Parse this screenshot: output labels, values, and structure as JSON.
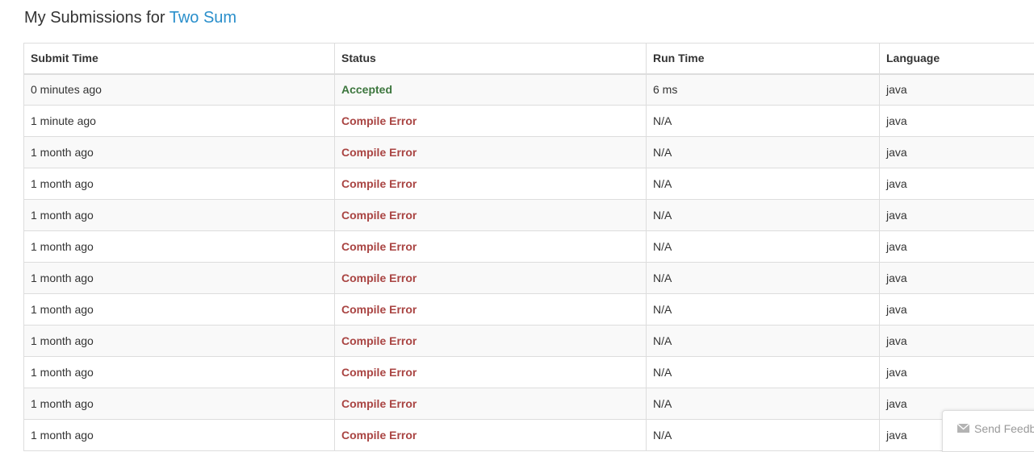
{
  "heading": {
    "prefix": "My Submissions for",
    "problem_link": "Two Sum"
  },
  "table": {
    "columns": [
      "Submit Time",
      "Status",
      "Run Time",
      "Language"
    ],
    "rows": [
      {
        "time": "0 minutes ago",
        "status": "Accepted",
        "runtime": "6 ms",
        "language": "java"
      },
      {
        "time": "1 minute ago",
        "status": "Compile Error",
        "runtime": "N/A",
        "language": "java"
      },
      {
        "time": "1 month ago",
        "status": "Compile Error",
        "runtime": "N/A",
        "language": "java"
      },
      {
        "time": "1 month ago",
        "status": "Compile Error",
        "runtime": "N/A",
        "language": "java"
      },
      {
        "time": "1 month ago",
        "status": "Compile Error",
        "runtime": "N/A",
        "language": "java"
      },
      {
        "time": "1 month ago",
        "status": "Compile Error",
        "runtime": "N/A",
        "language": "java"
      },
      {
        "time": "1 month ago",
        "status": "Compile Error",
        "runtime": "N/A",
        "language": "java"
      },
      {
        "time": "1 month ago",
        "status": "Compile Error",
        "runtime": "N/A",
        "language": "java"
      },
      {
        "time": "1 month ago",
        "status": "Compile Error",
        "runtime": "N/A",
        "language": "java"
      },
      {
        "time": "1 month ago",
        "status": "Compile Error",
        "runtime": "N/A",
        "language": "java"
      },
      {
        "time": "1 month ago",
        "status": "Compile Error",
        "runtime": "N/A",
        "language": "java"
      },
      {
        "time": "1 month ago",
        "status": "Compile Error",
        "runtime": "N/A",
        "language": "java"
      }
    ]
  },
  "feedback": {
    "label": "Send Feedback",
    "icon": "envelope-icon"
  },
  "colors": {
    "link": "#2a8fcb",
    "accepted": "#3c763d",
    "error": "#a94442",
    "border": "#dddddd",
    "stripe": "#f9f9f9"
  }
}
